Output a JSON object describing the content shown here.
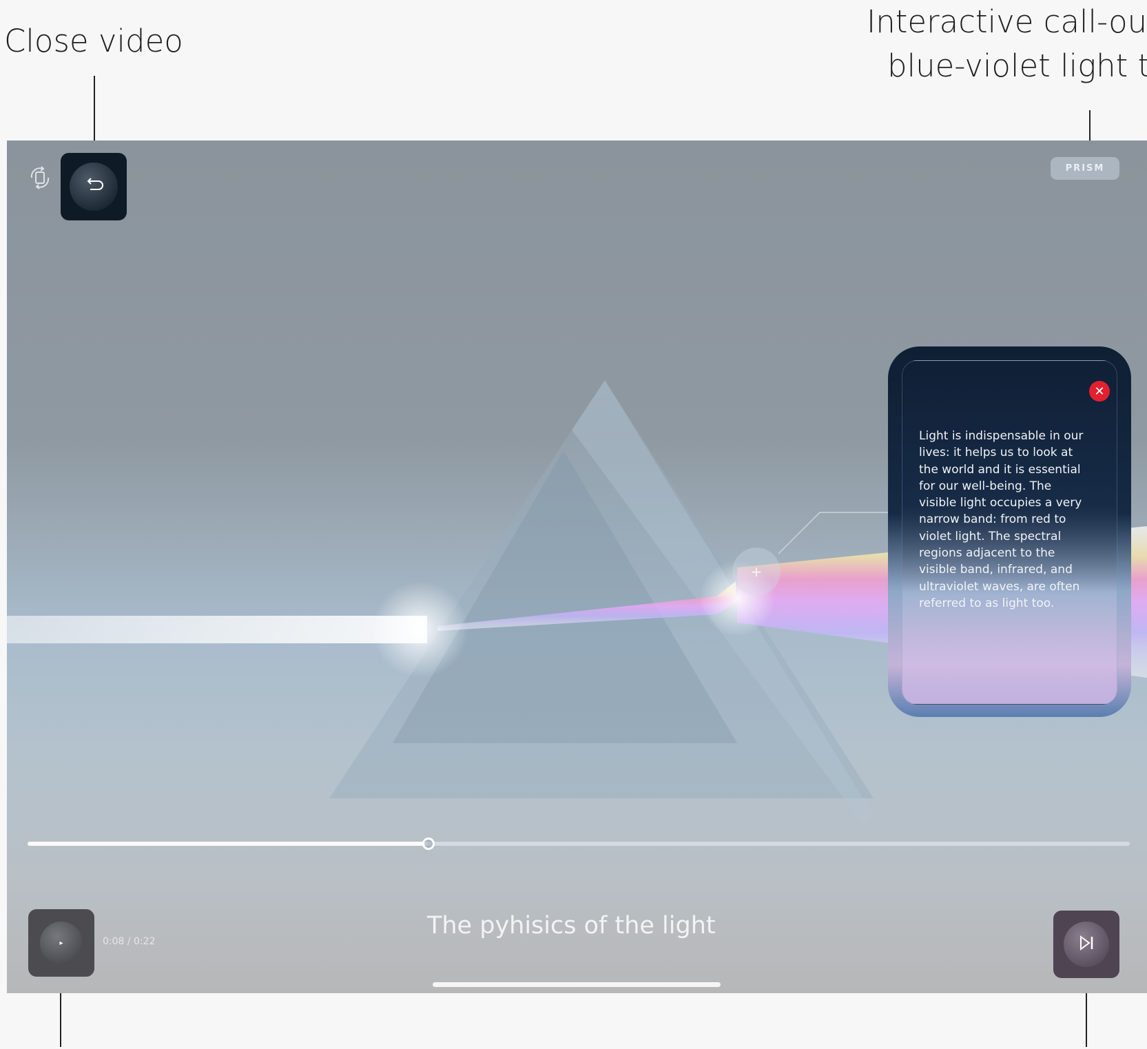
{
  "annotations": {
    "close_video": "Close video",
    "callouts_line1": "Interactive call-outs",
    "callouts_line2": "blue-violet light te"
  },
  "player": {
    "badge": "PRISM",
    "callout_text": "Light is indispensable in our lives: it helps us to look at the world and it is essential for our well-being. The visible light occupies a very narrow band: from red to violet light. The spectral regions adjacent to the visible band, infrared, and ultraviolet waves, are often referred to as light too.",
    "hotspot_symbol": "+",
    "close_symbol": "✕",
    "play_symbol": "▸",
    "time": "0:08 / 0:22",
    "title": "The pyhisics of the light",
    "progress_fraction": 0.3636
  },
  "icons": [
    "rotate-icon",
    "back-arrow-icon",
    "close-icon",
    "plus-icon",
    "play-icon",
    "skip-next-icon"
  ],
  "colors": {
    "close_red": "#e22030",
    "back_button_bg": "#0f1a27",
    "callout_top": "#0f1f34"
  }
}
